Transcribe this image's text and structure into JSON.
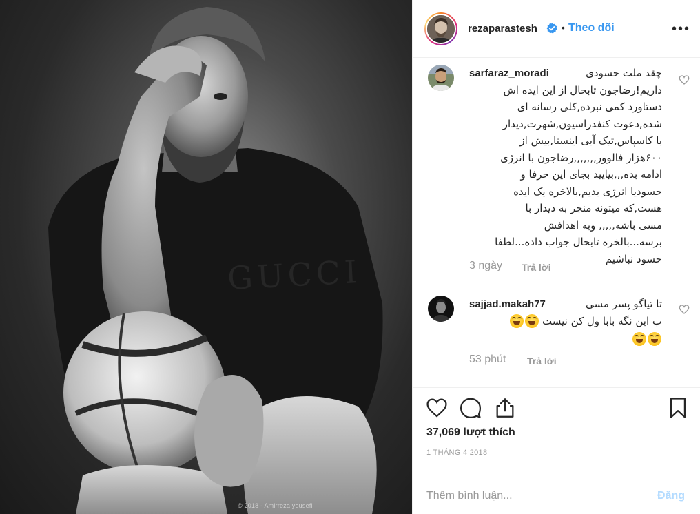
{
  "photo": {
    "shirt_print": "GUCCI",
    "credit": "© 2018 - Amirreza yousefi"
  },
  "header": {
    "username": "rezaparastesh",
    "separator": "•",
    "follow_label": "Theo dõi",
    "more_label": "•••"
  },
  "comments": [
    {
      "username": "sarfaraz_moradi",
      "first_line": "چقد ملت حسودی",
      "lines": [
        "داریم!رضاجون تابحال از این ایده اش",
        "دستاورد کمی نبرده,کلی رسانه ای",
        "شده,دعوت کنفدراسیون,شهرت,دیدار",
        "با کاسپاس,تیک آبی اینستا,بیش از",
        "۶۰۰هزار فالوور,,,,,,,رضاجون با انرژی",
        "ادامه بده,,,بیایید بجای این حرفا و",
        "حسودیا انرژی بدیم,بالاخره یک ایده",
        "هست,که میتونه منجر به دیدار با",
        "مسی باشه,,,,, وبه اهدافش",
        "برسه...بالخره تابحال جواب داده...لطفا",
        "حسود نباشیم"
      ],
      "time": "3 ngày",
      "reply_label": "Trả lời"
    },
    {
      "username": "sajjad.makah77",
      "first_line": "تا تیاگو پسر مسی",
      "lines": [
        "ب این نگه بابا ول کن نیست"
      ],
      "time": "53 phút",
      "reply_label": "Trả lời"
    }
  ],
  "actions": {
    "likes": "37,069 lượt thích",
    "date": "1 THÁNG 4 2018"
  },
  "add_comment": {
    "placeholder": "Thêm bình luận...",
    "post_label": "Đăng"
  },
  "colors": {
    "accent": "#3897f0",
    "post_disabled": "#b3dbff",
    "muted": "#999999",
    "text": "#262626",
    "divider": "#efefef"
  },
  "icons": [
    "verified-badge-icon",
    "more-options-icon",
    "heart-outline-icon",
    "comment-icon",
    "share-icon",
    "bookmark-icon"
  ]
}
